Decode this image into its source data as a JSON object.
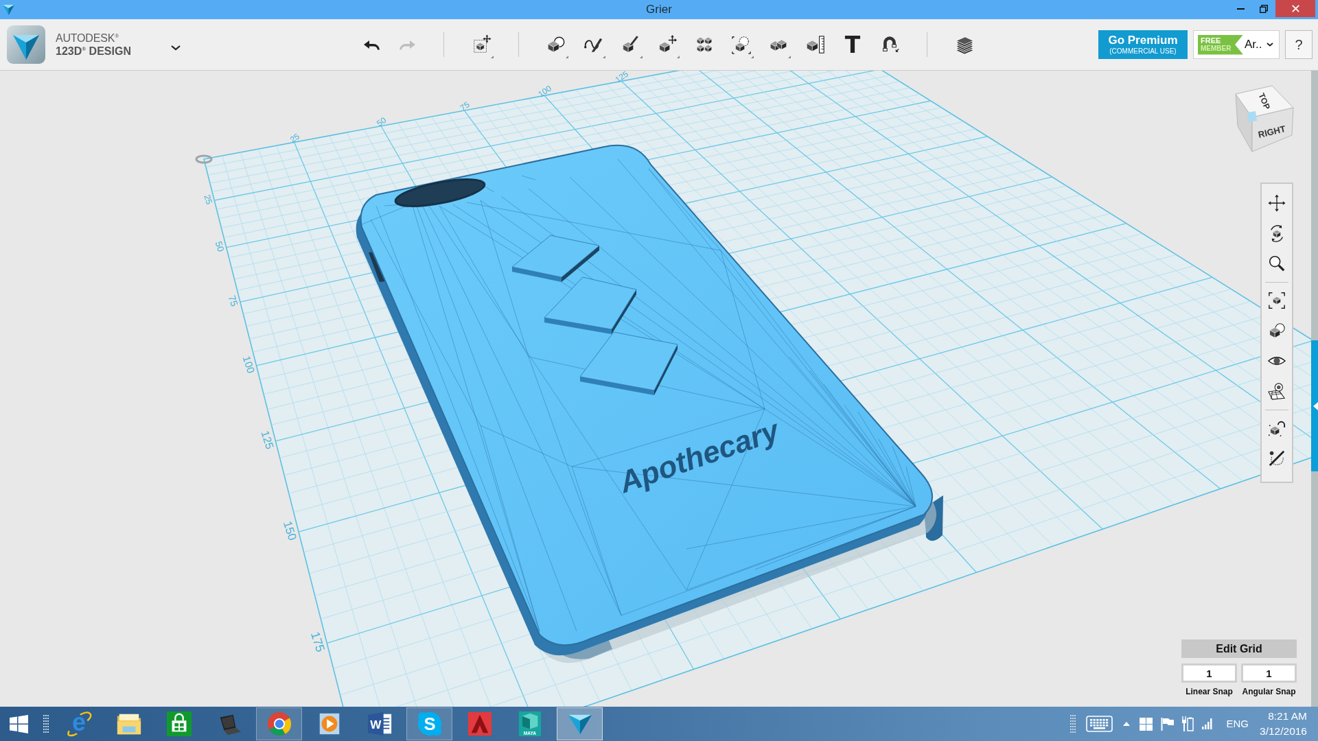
{
  "window": {
    "title": "Grier",
    "controls": [
      {
        "kind": "minimize"
      },
      {
        "kind": "restore"
      },
      {
        "kind": "close"
      }
    ]
  },
  "brand": {
    "line_1": "AUTODESK$^{®}$",
    "line_2": "123D$^{®}$ DESIGN"
  },
  "toolbar": {
    "history": [
      {
        "kind": "undo",
        "disabled": false
      },
      {
        "kind": "redo",
        "disabled": true
      }
    ],
    "tools": [
      {
        "kind": "separator"
      },
      {
        "kind": "transform",
        "dropdown": true
      },
      {
        "kind": "separator"
      },
      {
        "kind": "primitives",
        "dropdown": true
      },
      {
        "kind": "sketch",
        "dropdown": true
      },
      {
        "kind": "construct",
        "dropdown": true
      },
      {
        "kind": "modify",
        "dropdown": true
      },
      {
        "kind": "pattern",
        "dropdown": false
      },
      {
        "kind": "grouping",
        "dropdown": true
      },
      {
        "kind": "combine",
        "dropdown": true
      },
      {
        "kind": "measure",
        "dropdown": false
      },
      {
        "kind": "text",
        "glyph": "T",
        "dropdown": false
      },
      {
        "kind": "snap",
        "dropdown": false
      },
      {
        "kind": "separator"
      },
      {
        "kind": "materials",
        "dropdown": false
      }
    ]
  },
  "premium": {
    "title": "Go Premium",
    "subtitle": "(COMMERCIAL USE)"
  },
  "account": {
    "plan_line_1": "FREE",
    "plan_line_2": "MEMBER",
    "user": "Ar.."
  },
  "help": {
    "label": "?"
  },
  "viewport": {
    "grid": {
      "top_labels": [
        "25",
        "50",
        "75",
        "100",
        "125"
      ],
      "side_labels": [
        "25",
        "50",
        "75",
        "100",
        "125",
        "150",
        "175"
      ]
    },
    "model": {
      "embossed_text": "Apothecary"
    },
    "view_cube": {
      "faces": [
        {
          "kind": "top",
          "label": "TOP"
        },
        {
          "kind": "right",
          "label": "RIGHT"
        }
      ]
    },
    "navigation": [
      {
        "kind": "pan"
      },
      {
        "kind": "orbit"
      },
      {
        "kind": "zoom"
      },
      {
        "kind": "separator"
      },
      {
        "kind": "fit"
      },
      {
        "kind": "isolate"
      },
      {
        "kind": "visibility"
      },
      {
        "kind": "grid"
      },
      {
        "kind": "separator"
      },
      {
        "kind": "snap"
      },
      {
        "kind": "measure"
      }
    ],
    "edit_grid": {
      "title": "Edit Grid",
      "fields": [
        {
          "value": "1",
          "label": "Linear Snap"
        },
        {
          "value": "1",
          "label": "Angular Snap"
        }
      ]
    }
  },
  "taskbar": {
    "apps": [
      {
        "kind": "browser",
        "glyph": "e",
        "running": false,
        "selected": false
      },
      {
        "kind": "files",
        "running": false,
        "selected": false
      },
      {
        "kind": "store",
        "running": false,
        "selected": false
      },
      {
        "kind": "laptop",
        "running": false,
        "selected": false
      },
      {
        "kind": "web",
        "running": true,
        "selected": false
      },
      {
        "kind": "player",
        "running": false,
        "selected": false
      },
      {
        "kind": "writer",
        "glyph": "W",
        "running": false,
        "selected": false
      },
      {
        "kind": "messenger",
        "glyph": "S",
        "running": true,
        "selected": false
      },
      {
        "kind": "cad",
        "running": false,
        "selected": false
      },
      {
        "kind": "animation",
        "caption": "MAYA",
        "running": false,
        "selected": false
      },
      {
        "kind": "design",
        "running": true,
        "selected": true
      }
    ],
    "tray": [
      {
        "kind": "keyboard"
      },
      {
        "kind": "chevron"
      },
      {
        "kind": "windows"
      },
      {
        "kind": "flag"
      },
      {
        "kind": "power"
      },
      {
        "kind": "signal"
      }
    ],
    "language": "ENG",
    "time": "8:21 AM",
    "date": "3/12/2016"
  }
}
